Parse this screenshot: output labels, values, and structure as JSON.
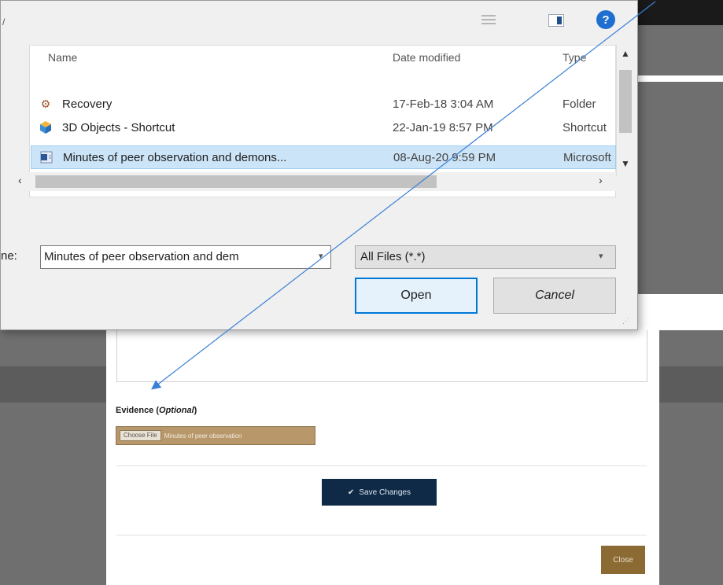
{
  "dialog": {
    "columns": {
      "name": "Name",
      "date": "Date modified",
      "type": "Type"
    },
    "files": [
      {
        "name": "Recovery",
        "date": "17-Feb-18 3:04 AM",
        "type": "Folder",
        "icon": "recovery-folder-icon"
      },
      {
        "name": "3D Objects - Shortcut",
        "date": "22-Jan-19 8:57 PM",
        "type": "Shortcut",
        "icon": "3d-objects-icon"
      },
      {
        "name": "Minutes of peer observation and demons...",
        "date": "08-Aug-20 9:59 PM",
        "type": "Microsoft",
        "icon": "word-document-icon",
        "selected": true
      }
    ],
    "file_name_label": "ne:",
    "file_name_value": "Minutes of peer observation and dem",
    "file_type_value": "All Files (*.*)",
    "open_label": "Open",
    "cancel_label": "Cancel",
    "help_glyph": "?",
    "corner_glyph": "/"
  },
  "page": {
    "evidence_label": "Evidence (",
    "evidence_optional": "Optional",
    "evidence_close": ")",
    "choose_label": "Choose File",
    "chosen_file": "Minutes of peer observation",
    "save_label": "Save Changes",
    "close_label": "Close"
  },
  "colors": {
    "dialog_bg": "#f0f0f0",
    "selected_row": "#cce4f7",
    "accent_blue": "#0078d7",
    "save_button": "#0e2a47",
    "file_input": "#b8976a",
    "close_button": "#8c6a33",
    "arrow": "#3b7fd6"
  }
}
